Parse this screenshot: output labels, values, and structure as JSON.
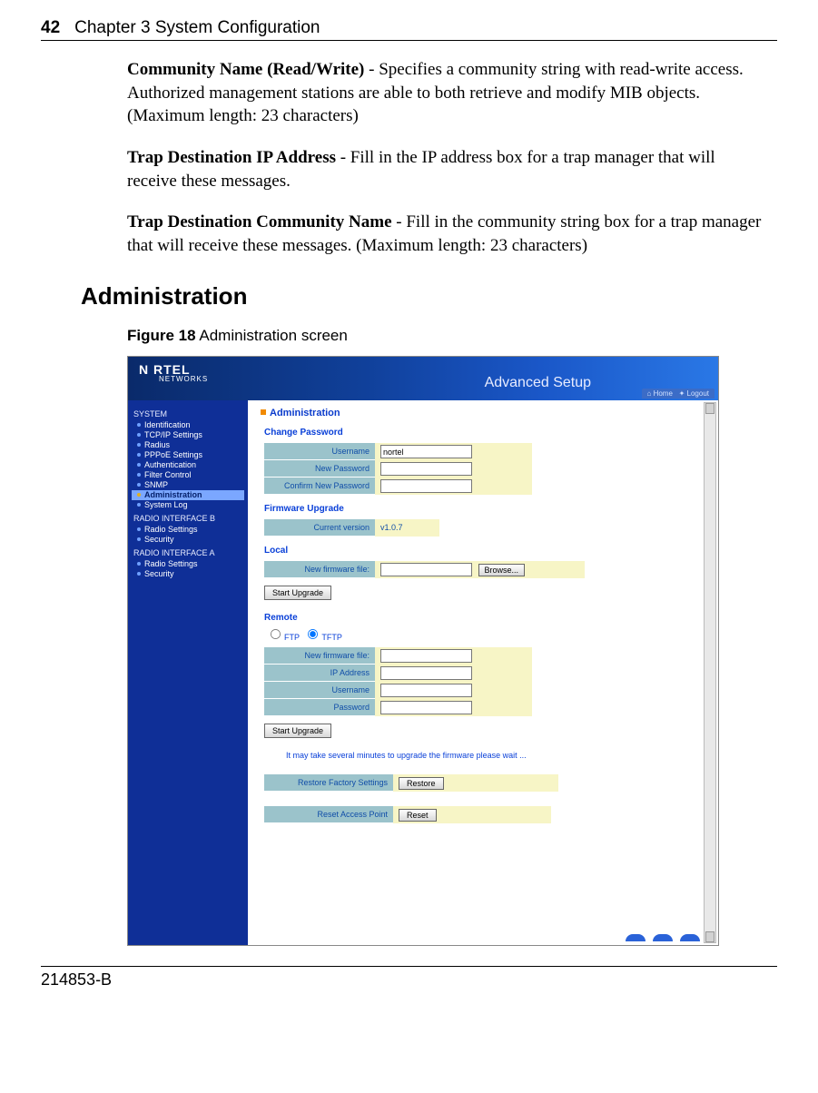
{
  "header": {
    "page_number": "42",
    "chapter": "Chapter 3  System Configuration"
  },
  "paragraphs": {
    "p1_bold": "Community Name (Read/Write)",
    "p1_rest": " - Specifies a community string with read-write access. Authorized management stations are able to both retrieve and modify MIB objects. (Maximum length: 23 characters)",
    "p2_bold": "Trap Destination IP Address",
    "p2_rest": " - Fill in the IP address box for a trap manager that will receive these messages.",
    "p3_bold": "Trap Destination Community Name",
    "p3_rest": " - Fill in the community string box for a trap manager that will receive these messages. (Maximum length: 23 characters)"
  },
  "section_heading": "Administration",
  "figure": {
    "label_bold": "Figure 18",
    "label_rest": "   Administration screen"
  },
  "screenshot": {
    "logo_main": "N  RTEL",
    "logo_sub": "NETWORKS",
    "banner_title": "Advanced Setup",
    "linkbar_home": "Home",
    "linkbar_logout": "Logout",
    "sidebar": {
      "group_system": "SYSTEM",
      "items_system": [
        "Identification",
        "TCP/IP Settings",
        "Radius",
        "PPPoE Settings",
        "Authentication",
        "Filter Control",
        "SNMP",
        "Administration",
        "System Log"
      ],
      "group_radio_b": "RADIO INTERFACE B",
      "items_radio_b": [
        "Radio Settings",
        "Security"
      ],
      "group_radio_a": "RADIO INTERFACE A",
      "items_radio_a": [
        "Radio Settings",
        "Security"
      ]
    },
    "main": {
      "page_title": "Administration",
      "change_password": {
        "heading": "Change Password",
        "username_label": "Username",
        "username_value": "nortel",
        "new_password_label": "New Password",
        "confirm_label": "Confirm New Password"
      },
      "firmware_upgrade": {
        "heading": "Firmware Upgrade",
        "current_version_label": "Current version",
        "current_version_value": "v1.0.7"
      },
      "local": {
        "heading": "Local",
        "new_firmware_label": "New firmware file:",
        "browse_button": "Browse...",
        "start_button": "Start Upgrade"
      },
      "remote": {
        "heading": "Remote",
        "ftp_label": "FTP",
        "tftp_label": "TFTP",
        "new_firmware_label": "New firmware file:",
        "ip_label": "IP Address",
        "username_label": "Username",
        "password_label": "Password",
        "start_button": "Start Upgrade",
        "note": "It may take several minutes to upgrade the firmware please wait ..."
      },
      "restore": {
        "label": "Restore Factory Settings",
        "button": "Restore"
      },
      "reset": {
        "label": "Reset Access Point",
        "button": "Reset"
      }
    }
  },
  "footer": {
    "doc_id": "214853-B"
  }
}
